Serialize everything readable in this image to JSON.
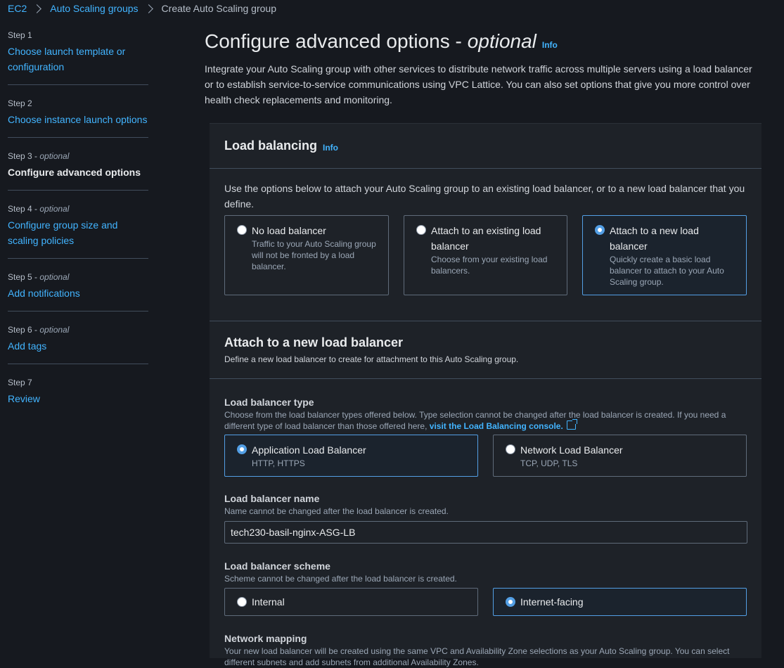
{
  "breadcrumb": {
    "items": [
      "EC2",
      "Auto Scaling groups"
    ],
    "current": "Create Auto Scaling group"
  },
  "steps": [
    {
      "num": "Step 1",
      "optional": "",
      "title": "Choose launch template or configuration"
    },
    {
      "num": "Step 2",
      "optional": "",
      "title": "Choose instance launch options"
    },
    {
      "num": "Step 3 - ",
      "optional": "optional",
      "title": "Configure advanced options"
    },
    {
      "num": "Step 4 - ",
      "optional": "optional",
      "title": "Configure group size and scaling policies"
    },
    {
      "num": "Step 5 - ",
      "optional": "optional",
      "title": "Add notifications"
    },
    {
      "num": "Step 6 - ",
      "optional": "optional",
      "title": "Add tags"
    },
    {
      "num": "Step 7",
      "optional": "",
      "title": "Review"
    }
  ],
  "page": {
    "title": "Configure advanced options -",
    "title_optional": "optional",
    "info": "Info",
    "intro": "Integrate your Auto Scaling group with other services to distribute network traffic across multiple servers using a load balancer or to establish service-to-service communications using VPC Lattice. You can also set options that give you more control over health check replacements and monitoring."
  },
  "load_balancing": {
    "title": "Load balancing",
    "info": "Info",
    "description": "Use the options below to attach your Auto Scaling group to an existing load balancer, or to a new load balancer that you define.",
    "options": [
      {
        "label": "No load balancer",
        "sub": "Traffic to your Auto Scaling group will not be fronted by a load balancer.",
        "selected": false
      },
      {
        "label": "Attach to an existing load balancer",
        "sub": "Choose from your existing load balancers.",
        "selected": false
      },
      {
        "label": "Attach to a new load balancer",
        "sub": "Quickly create a basic load balancer to attach to your Auto Scaling group.",
        "selected": true
      }
    ]
  },
  "new_lb": {
    "title": "Attach to a new load balancer",
    "subtitle": "Define a new load balancer to create for attachment to this Auto Scaling group.",
    "type": {
      "label": "Load balancer type",
      "desc": "Choose from the load balancer types offered below. Type selection cannot be changed after the load balancer is created. If you need a different type of load balancer than those offered here,",
      "link": "visit the Load Balancing console.",
      "options": [
        {
          "label": "Application Load Balancer",
          "sub": "HTTP, HTTPS",
          "selected": true
        },
        {
          "label": "Network Load Balancer",
          "sub": "TCP, UDP, TLS",
          "selected": false
        }
      ]
    },
    "name": {
      "label": "Load balancer name",
      "desc": "Name cannot be changed after the load balancer is created.",
      "value": "tech230-basil-nginx-ASG-LB"
    },
    "scheme": {
      "label": "Load balancer scheme",
      "desc": "Scheme cannot be changed after the load balancer is created.",
      "options": [
        {
          "label": "Internal",
          "selected": false
        },
        {
          "label": "Internet-facing",
          "selected": true
        }
      ]
    },
    "network": {
      "label": "Network mapping",
      "desc": "Your new load balancer will be created using the same VPC and Availability Zone selections as your Auto Scaling group. You can select different subnets and add subnets from additional Availability Zones."
    }
  }
}
